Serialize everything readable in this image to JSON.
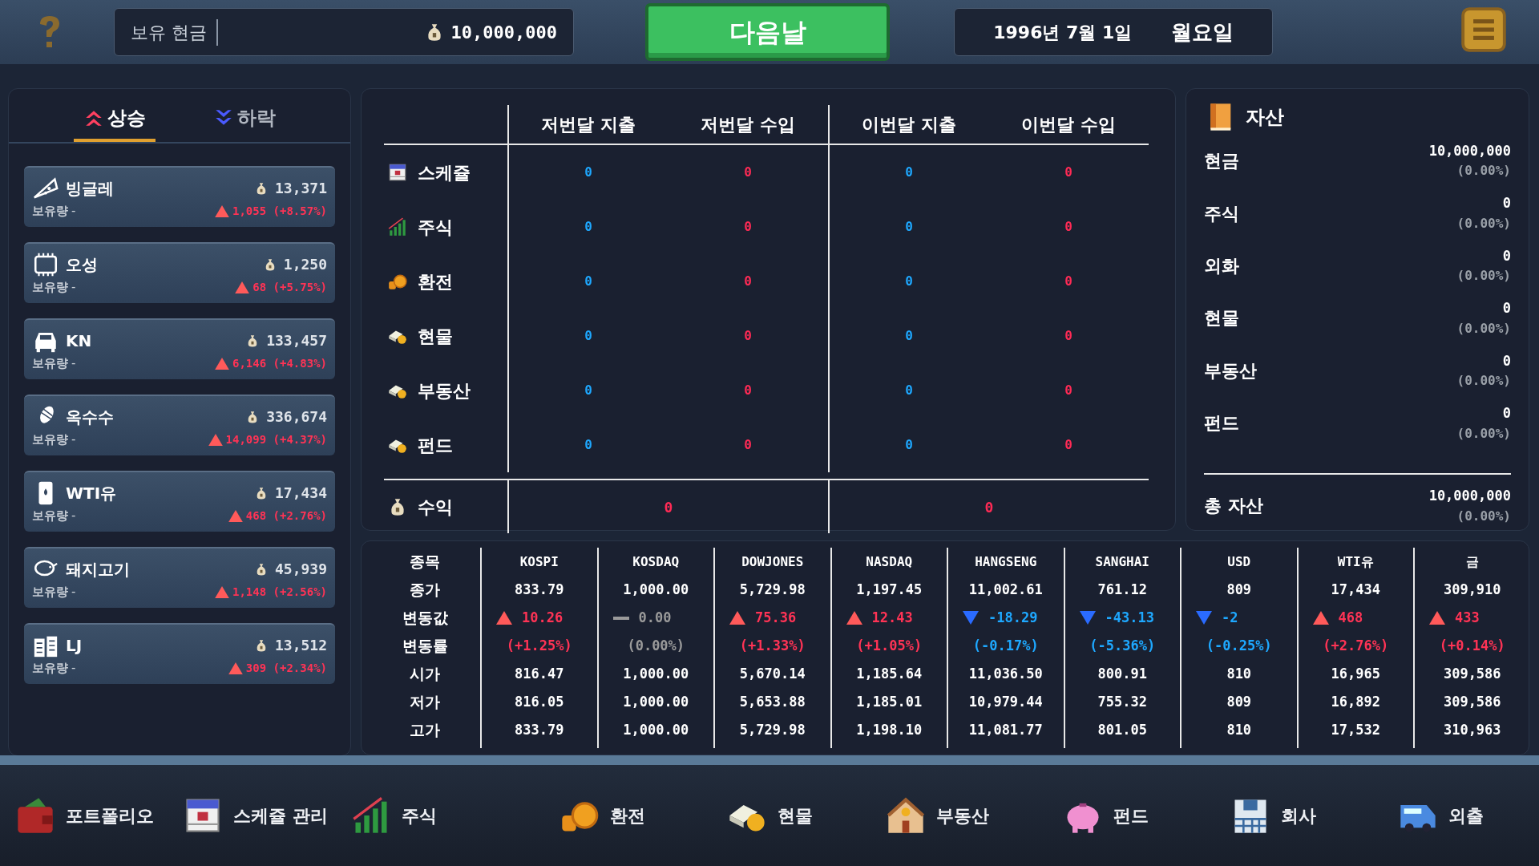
{
  "top_bar": {
    "cash_label": "보유 현금",
    "cash_value": "10,000,000",
    "next_button": "다음날",
    "date": "1996년 7월 1일",
    "weekday": "월요일"
  },
  "movers": {
    "tabs": [
      {
        "label": "상승",
        "selected": true
      },
      {
        "label": "하락",
        "selected": false
      }
    ],
    "items": [
      {
        "name": "빙글레",
        "price": "13,371",
        "holding_label": "보유량",
        "holding": "-",
        "change": "1,055 (+8.57%)",
        "kind": "up"
      },
      {
        "name": "오성",
        "price": "1,250",
        "holding_label": "보유량",
        "holding": "-",
        "change": "68 (+5.75%)",
        "kind": "up"
      },
      {
        "name": "KN",
        "price": "133,457",
        "holding_label": "보유량",
        "holding": "-",
        "change": "6,146 (+4.83%)",
        "kind": "up"
      },
      {
        "name": "옥수수",
        "price": "336,674",
        "holding_label": "보유량",
        "holding": "-",
        "change": "14,099 (+4.37%)",
        "kind": "up"
      },
      {
        "name": "WTI유",
        "price": "17,434",
        "holding_label": "보유량",
        "holding": "-",
        "change": "468 (+2.76%)",
        "kind": "up"
      },
      {
        "name": "돼지고기",
        "price": "45,939",
        "holding_label": "보유량",
        "holding": "-",
        "change": "1,148 (+2.56%)",
        "kind": "up"
      },
      {
        "name": "LJ",
        "price": "13,512",
        "holding_label": "보유량",
        "holding": "-",
        "change": "309 (+2.34%)",
        "kind": "up"
      }
    ]
  },
  "cashflow": {
    "columns": [
      "저번달 지출",
      "저번달 수입",
      "이번달 지출",
      "이번달 수입"
    ],
    "rows": [
      {
        "label": "스케쥴",
        "values": [
          "0",
          "0",
          "0",
          "0"
        ]
      },
      {
        "label": "주식",
        "values": [
          "0",
          "0",
          "0",
          "0"
        ]
      },
      {
        "label": "환전",
        "values": [
          "0",
          "0",
          "0",
          "0"
        ]
      },
      {
        "label": "현물",
        "values": [
          "0",
          "0",
          "0",
          "0"
        ]
      },
      {
        "label": "부동산",
        "values": [
          "0",
          "0",
          "0",
          "0"
        ]
      },
      {
        "label": "펀드",
        "values": [
          "0",
          "0",
          "0",
          "0"
        ]
      }
    ],
    "profit": {
      "label": "수익",
      "values": [
        "0",
        "0"
      ]
    }
  },
  "assets": {
    "title": "자산",
    "items": [
      {
        "label": "현금",
        "value": "10,000,000",
        "share": "(0.00%)"
      },
      {
        "label": "주식",
        "value": "0",
        "share": "(0.00%)"
      },
      {
        "label": "외화",
        "value": "0",
        "share": "(0.00%)"
      },
      {
        "label": "현물",
        "value": "0",
        "share": "(0.00%)"
      },
      {
        "label": "부동산",
        "value": "0",
        "share": "(0.00%)"
      },
      {
        "label": "펀드",
        "value": "0",
        "share": "(0.00%)"
      }
    ],
    "total": {
      "label": "총 자산",
      "value": "10,000,000",
      "share": "(0.00%)"
    }
  },
  "market": {
    "row_labels": [
      "종목",
      "종가",
      "변동값",
      "변동률",
      "시가",
      "저가",
      "고가"
    ],
    "columns": [
      {
        "name": "KOSPI",
        "close": "833.79",
        "change": "10.26",
        "kind": "up",
        "rate": "(+1.25%)",
        "open": "816.47",
        "low": "816.05",
        "high": "833.79"
      },
      {
        "name": "KOSDAQ",
        "close": "1,000.00",
        "change": "0.00",
        "kind": "flat",
        "rate": "(0.00%)",
        "open": "1,000.00",
        "low": "1,000.00",
        "high": "1,000.00"
      },
      {
        "name": "DOWJONES",
        "close": "5,729.98",
        "change": "75.36",
        "kind": "up",
        "rate": "(+1.33%)",
        "open": "5,670.14",
        "low": "5,653.88",
        "high": "5,729.98"
      },
      {
        "name": "NASDAQ",
        "close": "1,197.45",
        "change": "12.43",
        "kind": "up",
        "rate": "(+1.05%)",
        "open": "1,185.64",
        "low": "1,185.01",
        "high": "1,198.10"
      },
      {
        "name": "HANGSENG",
        "close": "11,002.61",
        "change": "-18.29",
        "kind": "down",
        "rate": "(-0.17%)",
        "open": "11,036.50",
        "low": "10,979.44",
        "high": "11,081.77"
      },
      {
        "name": "SANGHAI",
        "close": "761.12",
        "change": "-43.13",
        "kind": "down",
        "rate": "(-5.36%)",
        "open": "800.91",
        "low": "755.32",
        "high": "801.05"
      },
      {
        "name": "USD",
        "close": "809",
        "change": "-2",
        "kind": "down",
        "rate": "(-0.25%)",
        "open": "810",
        "low": "809",
        "high": "810"
      },
      {
        "name": "WTI유",
        "close": "17,434",
        "change": "468",
        "kind": "up",
        "rate": "(+2.76%)",
        "open": "16,965",
        "low": "16,892",
        "high": "17,532"
      },
      {
        "name": "금",
        "close": "309,910",
        "change": "433",
        "kind": "up",
        "rate": "(+0.14%)",
        "open": "309,586",
        "low": "309,586",
        "high": "310,963"
      }
    ]
  },
  "nav": [
    {
      "label": "포트폴리오"
    },
    {
      "label": "스케쥴 관리"
    },
    {
      "label": "주식"
    },
    {
      "label": "환전"
    },
    {
      "label": "현물"
    },
    {
      "label": "부동산"
    },
    {
      "label": "펀드"
    },
    {
      "label": "회사"
    },
    {
      "label": "외출"
    }
  ]
}
